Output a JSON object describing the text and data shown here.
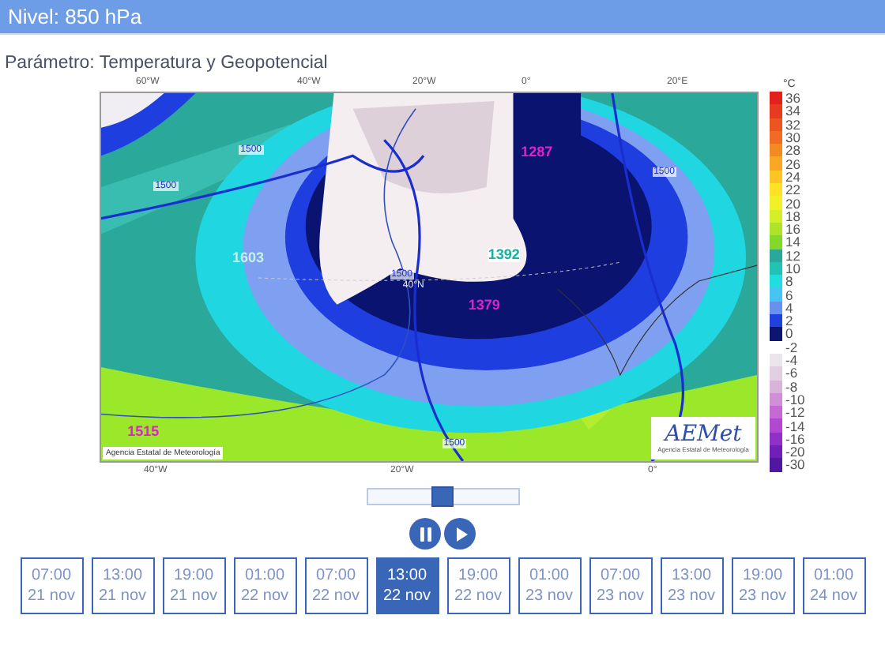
{
  "header": {
    "title": "Nivel: 850 hPa"
  },
  "parameter": "Parámetro: Temperatura y Geopotencial",
  "map": {
    "top_axis": [
      "60°W",
      "40°W",
      "20°W",
      "0°",
      "20°E"
    ],
    "bottom_axis": [
      "40°W",
      "20°W",
      "0°"
    ],
    "labels": [
      {
        "text": "1287",
        "kind": "low"
      },
      {
        "text": "1392",
        "kind": "mid"
      },
      {
        "text": "1379",
        "kind": "low"
      },
      {
        "text": "1603",
        "kind": "faint"
      },
      {
        "text": "1515",
        "kind": "low"
      },
      {
        "text": "40°N",
        "kind": "grid"
      },
      {
        "text": "1500",
        "kind": "contour"
      },
      {
        "text": "1500",
        "kind": "contour"
      },
      {
        "text": "1500",
        "kind": "contour"
      },
      {
        "text": "1500",
        "kind": "contour"
      },
      {
        "text": "1500",
        "kind": "contour"
      }
    ],
    "credit": "Agencia Estatal de Meteorología",
    "logo": {
      "name": "AEMet",
      "subtitle": "Agencia Estatal de Meteorología"
    }
  },
  "legend": {
    "unit": "°C",
    "items": [
      {
        "label": "36",
        "color": "#e3201c"
      },
      {
        "label": "34",
        "color": "#e73a1e"
      },
      {
        "label": "32",
        "color": "#ec5420"
      },
      {
        "label": "30",
        "color": "#f06c22"
      },
      {
        "label": "28",
        "color": "#f48a22"
      },
      {
        "label": "26",
        "color": "#f8a822"
      },
      {
        "label": "24",
        "color": "#fbc624"
      },
      {
        "label": "22",
        "color": "#fde226"
      },
      {
        "label": "20",
        "color": "#f4f028"
      },
      {
        "label": "18",
        "color": "#d4ee28"
      },
      {
        "label": "16",
        "color": "#aee428"
      },
      {
        "label": "14",
        "color": "#84d82a"
      },
      {
        "label": "12",
        "color": "#2aa99a"
      },
      {
        "label": "10",
        "color": "#22c2b4"
      },
      {
        "label": "8",
        "color": "#20dede"
      },
      {
        "label": "6",
        "color": "#48c4f2"
      },
      {
        "label": "4",
        "color": "#6a90ee"
      },
      {
        "label": "2",
        "color": "#2040e0"
      },
      {
        "label": "0",
        "color": "#0c1670"
      },
      {
        "label": "-2",
        "color": "#ffffff"
      },
      {
        "label": "-4",
        "color": "#ece6ec"
      },
      {
        "label": "-6",
        "color": "#e2d0e2"
      },
      {
        "label": "-8",
        "color": "#d8b4d8"
      },
      {
        "label": "-10",
        "color": "#d090d6"
      },
      {
        "label": "-12",
        "color": "#c46ad2"
      },
      {
        "label": "-14",
        "color": "#b048d0"
      },
      {
        "label": "-16",
        "color": "#9030c8"
      },
      {
        "label": "-20",
        "color": "#7020b8"
      },
      {
        "label": "-30",
        "color": "#5018a0"
      }
    ]
  },
  "slider": {
    "level": 0.5
  },
  "controls": [
    {
      "kind": "pause"
    },
    {
      "kind": "play"
    }
  ],
  "times": [
    {
      "time": "07:00",
      "date": "21 nov",
      "selected": false
    },
    {
      "time": "13:00",
      "date": "21 nov",
      "selected": false
    },
    {
      "time": "19:00",
      "date": "21 nov",
      "selected": false
    },
    {
      "time": "01:00",
      "date": "22 nov",
      "selected": false
    },
    {
      "time": "07:00",
      "date": "22 nov",
      "selected": false
    },
    {
      "time": "13:00",
      "date": "22 nov",
      "selected": true
    },
    {
      "time": "19:00",
      "date": "22 nov",
      "selected": false
    },
    {
      "time": "01:00",
      "date": "23 nov",
      "selected": false
    },
    {
      "time": "07:00",
      "date": "23 nov",
      "selected": false
    },
    {
      "time": "13:00",
      "date": "23 nov",
      "selected": false
    },
    {
      "time": "19:00",
      "date": "23 nov",
      "selected": false
    },
    {
      "time": "01:00",
      "date": "24 nov",
      "selected": false
    }
  ]
}
